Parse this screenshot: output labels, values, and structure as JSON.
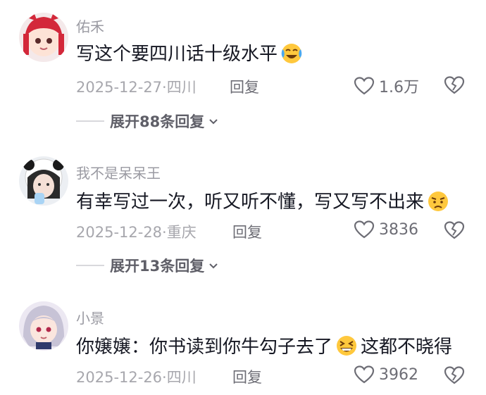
{
  "comments": [
    {
      "username": "佑禾",
      "text_before": "写这个要四川话十级水平",
      "emoji": "laughing-crying-emoji",
      "text_after": "",
      "meta": "2025-12-27·四川",
      "reply_label": "回复",
      "like_count": "1.6万",
      "expand_label": "展开88条回复"
    },
    {
      "username": "我不是呆呆王",
      "text_before": "有幸写过一次，听又听不懂，写又写不出来",
      "emoji": "frowning-emoji",
      "text_after": "",
      "meta": "2025-12-28·重庆",
      "reply_label": "回复",
      "like_count": "3836",
      "expand_label": "展开13条回复"
    },
    {
      "username": "小景",
      "text_before": "你嬢嬢：你书读到你牛勾子去了",
      "emoji": "grinning-squint-emoji",
      "text_after": "这都不晓得",
      "meta": "2025-12-26·四川",
      "reply_label": "回复",
      "like_count": "3962"
    }
  ],
  "colors": {
    "text": "#161823",
    "muted": "#a7a7ad",
    "accent_emoji": "#ffc83d"
  }
}
